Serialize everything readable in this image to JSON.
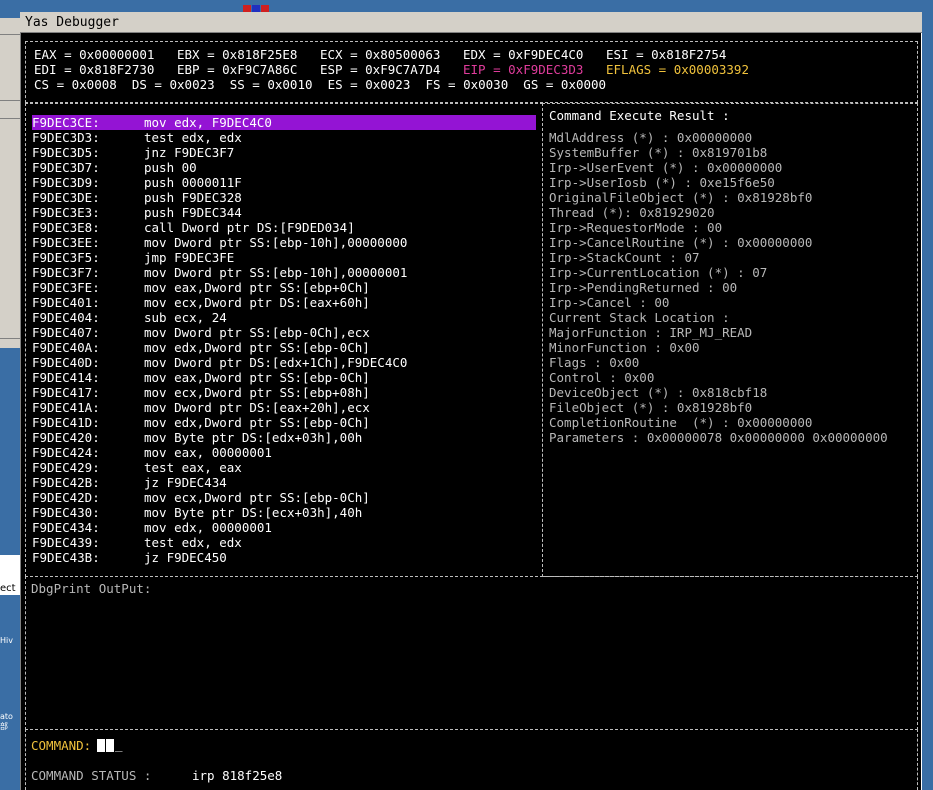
{
  "window": {
    "title": "Yas Debugger"
  },
  "registers": {
    "line1": [
      "EAX = 0x00000001",
      "EBX = 0x818F25E8",
      "ECX = 0x80500063",
      "EDX = 0xF9DEC4C0",
      "ESI = 0x818F2754"
    ],
    "line2": [
      "EDI = 0x818F2730",
      "EBP = 0xF9C7A86C",
      "ESP = 0xF9C7A7D4"
    ],
    "eip": "EIP = 0xF9DEC3D3",
    "eflags": "EFLAGS = 0x00003392",
    "line3": [
      "CS = 0x0008",
      "DS = 0x0023",
      "SS = 0x0010",
      "ES = 0x0023",
      "FS = 0x0030",
      "GS = 0x0000"
    ],
    "colors": {
      "eip": "#e03c9c",
      "eflags": "#f0c23c"
    }
  },
  "disassembly": [
    {
      "addr": "F9DEC3CE:",
      "ins": "mov edx, F9DEC4C0",
      "selected": true
    },
    {
      "addr": "F9DEC3D3:",
      "ins": "test edx, edx"
    },
    {
      "addr": "F9DEC3D5:",
      "ins": "jnz F9DEC3F7"
    },
    {
      "addr": "F9DEC3D7:",
      "ins": "push 00"
    },
    {
      "addr": "F9DEC3D9:",
      "ins": "push 0000011F"
    },
    {
      "addr": "F9DEC3DE:",
      "ins": "push F9DEC328"
    },
    {
      "addr": "F9DEC3E3:",
      "ins": "push F9DEC344"
    },
    {
      "addr": "F9DEC3E8:",
      "ins": "call Dword ptr DS:[F9DED034]"
    },
    {
      "addr": "F9DEC3EE:",
      "ins": "mov Dword ptr SS:[ebp-10h],00000000"
    },
    {
      "addr": "F9DEC3F5:",
      "ins": "jmp F9DEC3FE"
    },
    {
      "addr": "F9DEC3F7:",
      "ins": "mov Dword ptr SS:[ebp-10h],00000001"
    },
    {
      "addr": "F9DEC3FE:",
      "ins": "mov eax,Dword ptr SS:[ebp+0Ch]"
    },
    {
      "addr": "F9DEC401:",
      "ins": "mov ecx,Dword ptr DS:[eax+60h]"
    },
    {
      "addr": "F9DEC404:",
      "ins": "sub ecx, 24"
    },
    {
      "addr": "F9DEC407:",
      "ins": "mov Dword ptr SS:[ebp-0Ch],ecx"
    },
    {
      "addr": "F9DEC40A:",
      "ins": "mov edx,Dword ptr SS:[ebp-0Ch]"
    },
    {
      "addr": "F9DEC40D:",
      "ins": "mov Dword ptr DS:[edx+1Ch],F9DEC4C0"
    },
    {
      "addr": "F9DEC414:",
      "ins": "mov eax,Dword ptr SS:[ebp-0Ch]"
    },
    {
      "addr": "F9DEC417:",
      "ins": "mov ecx,Dword ptr SS:[ebp+08h]"
    },
    {
      "addr": "F9DEC41A:",
      "ins": "mov Dword ptr DS:[eax+20h],ecx"
    },
    {
      "addr": "F9DEC41D:",
      "ins": "mov edx,Dword ptr SS:[ebp-0Ch]"
    },
    {
      "addr": "F9DEC420:",
      "ins": "mov Byte ptr DS:[edx+03h],00h"
    },
    {
      "addr": "F9DEC424:",
      "ins": "mov eax, 00000001"
    },
    {
      "addr": "F9DEC429:",
      "ins": "test eax, eax"
    },
    {
      "addr": "F9DEC42B:",
      "ins": "jz F9DEC434"
    },
    {
      "addr": "F9DEC42D:",
      "ins": "mov ecx,Dword ptr SS:[ebp-0Ch]"
    },
    {
      "addr": "F9DEC430:",
      "ins": "mov Byte ptr DS:[ecx+03h],40h"
    },
    {
      "addr": "F9DEC434:",
      "ins": "mov edx, 00000001"
    },
    {
      "addr": "F9DEC439:",
      "ins": "test edx, edx"
    },
    {
      "addr": "F9DEC43B:",
      "ins": "jz F9DEC450"
    }
  ],
  "result": {
    "title": "Command Execute Result :",
    "lines": [
      "MdlAddress (*) : 0x00000000",
      "SystemBuffer (*) : 0x819701b8",
      "Irp->UserEvent (*) : 0x00000000",
      "Irp->UserIosb (*) : 0xe15f6e50",
      "OriginalFileObject (*) : 0x81928bf0",
      "Thread (*): 0x81929020",
      "Irp->RequestorMode : 00",
      "Irp->CancelRoutine (*) : 0x00000000",
      "Irp->StackCount : 07",
      "Irp->CurrentLocation (*) : 07",
      "Irp->PendingReturned : 00",
      "Irp->Cancel : 00",
      "Current Stack Location :",
      "MajorFunction : IRP_MJ_READ",
      "MinorFunction : 0x00",
      "Flags : 0x00",
      "Control : 0x00",
      "DeviceObject (*) : 0x818cbf18",
      "FileObject (*) : 0x81928bf0",
      "CompletionRoutine  (*) : 0x00000000",
      "Parameters : 0x00000078 0x00000000 0x00000000"
    ]
  },
  "dbgprint": {
    "label": "DbgPrint OutPut:"
  },
  "command": {
    "label": "COMMAND:",
    "status_label": "COMMAND STATUS :",
    "status_value": "irp 818f25e8"
  },
  "desktop": {
    "fragments": [
      "ect",
      "Hiv",
      "ato",
      "部"
    ]
  }
}
